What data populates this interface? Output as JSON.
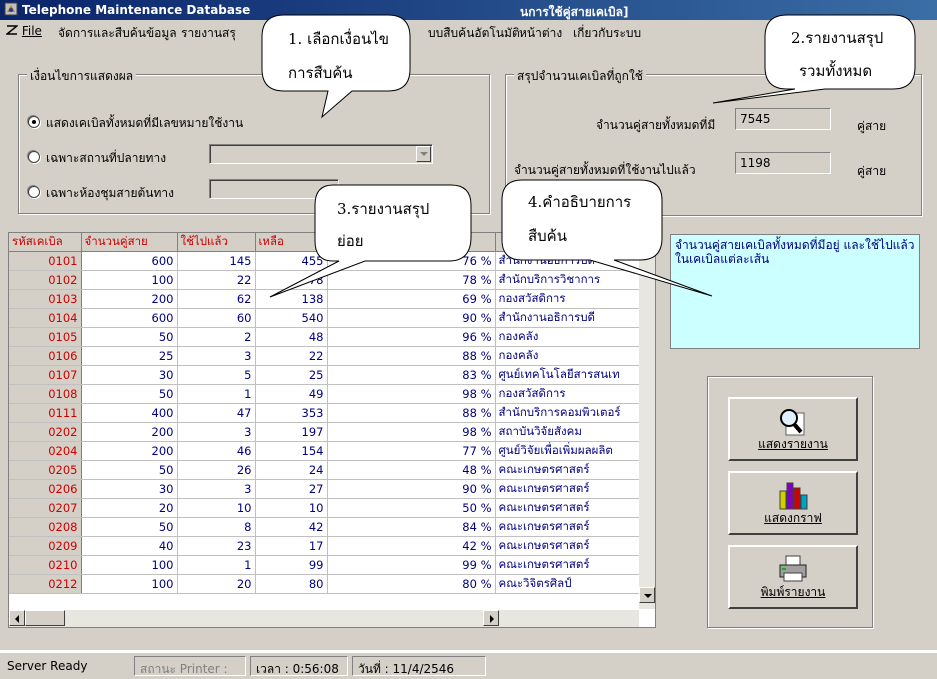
{
  "window": {
    "title_left": "Telephone Maintenance Database",
    "title_right": "นการใช้คู่สายเคเบิล]"
  },
  "menu": {
    "items": [
      {
        "label": "File",
        "icon": "app-menu-icon"
      },
      {
        "label": "จัดการและสืบค้นข้อมูล"
      },
      {
        "label": "รายงานสรุ"
      },
      {
        "label": "บบสืบค้นอัตโนมัติ"
      },
      {
        "label": "หน้าต่าง"
      },
      {
        "label": "เกี่ยวกับระบบ"
      }
    ]
  },
  "condition_group": {
    "title": "เงื่อนไขการแสดงผล",
    "options": [
      {
        "label": "แสดงเคเบิลทั้งหมดที่มีเลขหมายใช้งาน",
        "checked": true
      },
      {
        "label": "เฉพาะสถานที่ปลายทาง",
        "checked": false
      },
      {
        "label": "เฉพาะห้องชุมสายต้นทาง",
        "checked": false
      }
    ]
  },
  "summary_group": {
    "title": "สรุปจำนวนเคเบิลที่ถูกใช้",
    "total_label": "จำนวนคู่สายทั้งหมดที่มี",
    "total_value": "7545",
    "total_unit": "คู่สาย",
    "used_label": "จำนวนคู่สายทั้งหมดที่ใช้งานไปแล้ว",
    "used_value": "1198",
    "used_unit": "คู่สาย"
  },
  "grid": {
    "columns": [
      "รหัสเคเบิล",
      "จำนวนคู่สาย",
      "ใช้ไปแล้ว",
      "เหลือ",
      "",
      ""
    ],
    "rows": [
      [
        "0101",
        "600",
        "145",
        "455",
        "76 %",
        "สำนักงานอธิการบดี"
      ],
      [
        "0102",
        "100",
        "22",
        "78",
        "78 %",
        "สำนักบริการวิชาการ"
      ],
      [
        "0103",
        "200",
        "62",
        "138",
        "69 %",
        "กองสวัสดิการ"
      ],
      [
        "0104",
        "600",
        "60",
        "540",
        "90 %",
        "สำนักงานอธิการบดี"
      ],
      [
        "0105",
        "50",
        "2",
        "48",
        "96 %",
        "กองคลัง"
      ],
      [
        "0106",
        "25",
        "3",
        "22",
        "88 %",
        "กองคลัง"
      ],
      [
        "0107",
        "30",
        "5",
        "25",
        "83 %",
        "ศูนย์เทคโนโลยีสารสนเท"
      ],
      [
        "0108",
        "50",
        "1",
        "49",
        "98 %",
        "กองสวัสดิการ"
      ],
      [
        "0111",
        "400",
        "47",
        "353",
        "88 %",
        "สำนักบริการคอมพิวเตอร์"
      ],
      [
        "0202",
        "200",
        "3",
        "197",
        "98 %",
        "สถาบันวิจัยสังคม"
      ],
      [
        "0204",
        "200",
        "46",
        "154",
        "77 %",
        "ศูนย์วิจัยเพื่อเพิ่มผลผลิต"
      ],
      [
        "0205",
        "50",
        "26",
        "24",
        "48 %",
        "คณะเกษตรศาสตร์"
      ],
      [
        "0206",
        "30",
        "3",
        "27",
        "90 %",
        "คณะเกษตรศาสตร์"
      ],
      [
        "0207",
        "20",
        "10",
        "10",
        "50 %",
        "คณะเกษตรศาสตร์"
      ],
      [
        "0208",
        "50",
        "8",
        "42",
        "84 %",
        "คณะเกษตรศาสตร์"
      ],
      [
        "0209",
        "40",
        "23",
        "17",
        "42 %",
        "คณะเกษตรศาสตร์"
      ],
      [
        "0210",
        "100",
        "1",
        "99",
        "99 %",
        "คณะเกษตรศาสตร์"
      ],
      [
        "0212",
        "100",
        "20",
        "80",
        "80 %",
        "คณะวิจิตรศิลป์"
      ]
    ]
  },
  "description": {
    "text": "จำนวนคู่สายเคเบิลทั้งหมดที่มีอยู่ และใช้ไปแล้วในเคเบิลแต่ละเส้น"
  },
  "buttons": {
    "show_report": {
      "label": "แสดงรายงาน",
      "icon": "magnifier-report-icon"
    },
    "show_graph": {
      "label": "แสดงกราฟ",
      "icon": "bar-chart-icon"
    },
    "print_report": {
      "label": "พิมพ์รายงาน",
      "icon": "printer-icon"
    }
  },
  "status": {
    "ready": "Server Ready",
    "printer": "สถานะ Printer :",
    "time": "เวลา : 0:56:08",
    "date": "วันที่ : 11/4/2546"
  },
  "callouts": {
    "c1_line1": "1. เลือกเงื่อนไข",
    "c1_line2": "การสืบค้น",
    "c2_line1": "2.รายงานสรุป",
    "c2_line2": "รวมทั้งหมด",
    "c3_line1": "3.รายงานสรุป",
    "c3_line2": "ย่อย",
    "c4_line1": "4.คำอธิบายการ",
    "c4_line2": "สืบค้น"
  },
  "colors": {
    "title_bar": "#0a246a",
    "window_bg": "#d4d0c8",
    "grid_text": "#000080",
    "grid_header_text": "#cc0000",
    "description_bg": "#ccffff"
  }
}
